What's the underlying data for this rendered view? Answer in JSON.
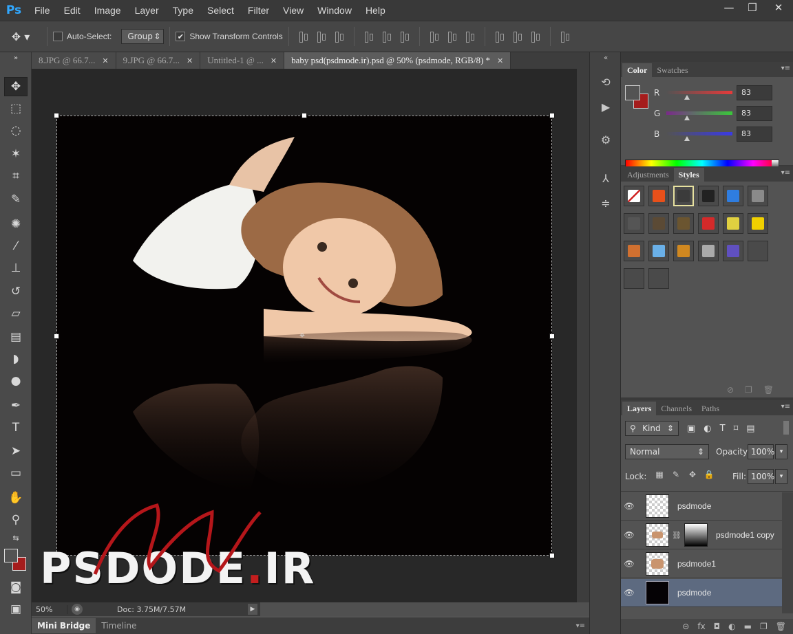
{
  "app": {
    "logo": "Ps"
  },
  "menu": [
    "File",
    "Edit",
    "Image",
    "Layer",
    "Type",
    "Select",
    "Filter",
    "View",
    "Window",
    "Help"
  ],
  "window_controls": {
    "minimize": "—",
    "restore": "❐",
    "close": "✕"
  },
  "options": {
    "auto_select_label": "Auto-Select:",
    "auto_select_checked": false,
    "auto_select_target": "Group",
    "show_transform_label": "Show Transform Controls",
    "show_transform_checked": true
  },
  "tabs": [
    {
      "label": "8.JPG @ 66.7...",
      "close": "✕"
    },
    {
      "label": "9.JPG @ 66.7...",
      "close": "✕"
    },
    {
      "label": "Untitled-1 @ ...",
      "close": "✕"
    },
    {
      "label": "baby psd(psdmode.ir).psd @ 50% (psdmode, RGB/8) *",
      "close": "✕",
      "active": true
    }
  ],
  "canvas": {
    "watermark_main": "PSDODE",
    "watermark_dot": ".",
    "watermark_suffix": "IR"
  },
  "status": {
    "zoom": "50%",
    "doc_info": "Doc: 3.75M/7.57M"
  },
  "bottom_tabs": [
    "Mini Bridge",
    "Timeline"
  ],
  "color_panel": {
    "tabs": [
      "Color",
      "Swatches"
    ],
    "r": {
      "label": "R",
      "value": "83"
    },
    "g": {
      "label": "G",
      "value": "83"
    },
    "b": {
      "label": "B",
      "value": "83"
    },
    "foreground": "#535353",
    "background": "#a51c1c"
  },
  "styles_panel": {
    "tabs": [
      "Adjustments",
      "Styles"
    ],
    "swatches": [
      "none",
      "#e8501a",
      "#3b3b3b",
      "#222222",
      "#2f7de0",
      "#8a8a8a",
      "#555555",
      "#5b4a35",
      "#6b5530",
      "#d42a2a",
      "#e0d040",
      "#f0d000",
      "#d07030",
      "#6ab0e8",
      "#d08820",
      "#aaaaaa",
      "#6050c0",
      "#4a4a4a",
      "#4a4a4a",
      "#4a4a4a"
    ]
  },
  "layers_panel": {
    "tabs": [
      "Layers",
      "Channels",
      "Paths"
    ],
    "kind_label": "Kind",
    "blend_mode": "Normal",
    "opacity_label": "Opacity:",
    "opacity_value": "100%",
    "lock_label": "Lock:",
    "fill_label": "Fill:",
    "fill_value": "100%",
    "layers": [
      {
        "name": "psdmode",
        "thumb": "checker"
      },
      {
        "name": "psdmode1 copy",
        "thumb": "photo",
        "mask": true
      },
      {
        "name": "psdmode1",
        "thumb": "photo"
      },
      {
        "name": "psdmode",
        "thumb": "black",
        "selected": true
      }
    ],
    "footer_icons": [
      "⊝",
      "fx",
      "◘",
      "◐",
      "▬",
      "❐",
      "🗑"
    ]
  }
}
